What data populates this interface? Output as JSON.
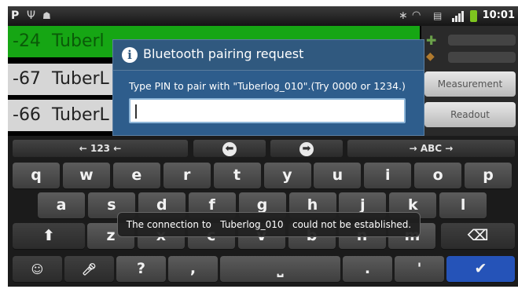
{
  "status_bar": {
    "time": "10:01",
    "left_icons": [
      "p-notification-icon",
      "usb-icon",
      "android-debug-icon"
    ],
    "right_icons": [
      "bluetooth-icon",
      "wifi-icon",
      "sd-card-icon",
      "signal-icon",
      "battery-icon"
    ],
    "p_glyph": "P"
  },
  "app": {
    "rows": [
      {
        "value": "-24",
        "name": "Tuberl"
      },
      {
        "value": "-67",
        "name": "TuberL"
      },
      {
        "value": "-66",
        "name": "TuberL"
      }
    ],
    "buttons": {
      "measurement": "Measurement",
      "readout": "Readout"
    }
  },
  "dialog": {
    "title": "Bluetooth pairing request",
    "message": "Type PIN to pair with \"Tuberlog_010\".(Try 0000 or 1234.)",
    "pin_value": ""
  },
  "toast": {
    "text": "The connection to   Tuberlog_010   could not be established."
  },
  "keyboard": {
    "top_row": {
      "symbols": "← 123 ←",
      "alpha": "→ ABC →"
    },
    "row1": [
      {
        "k": "q",
        "s": ""
      },
      {
        "k": "w",
        "s": ""
      },
      {
        "k": "e",
        "s": ""
      },
      {
        "k": "r",
        "s": ""
      },
      {
        "k": "t",
        "s": ""
      },
      {
        "k": "y",
        "s": ""
      },
      {
        "k": "u",
        "s": ""
      },
      {
        "k": "i",
        "s": ""
      },
      {
        "k": "o",
        "s": ""
      },
      {
        "k": "p",
        "s": ""
      }
    ],
    "row2": [
      {
        "k": "a",
        "s": ""
      },
      {
        "k": "s",
        "s": ""
      },
      {
        "k": "d",
        "s": ""
      },
      {
        "k": "f",
        "s": ""
      },
      {
        "k": "g",
        "s": ""
      },
      {
        "k": "h",
        "s": ""
      },
      {
        "k": "j",
        "s": ""
      },
      {
        "k": "k",
        "s": ""
      },
      {
        "k": "l",
        "s": ""
      }
    ],
    "row3": [
      {
        "k": "z",
        "s": ""
      },
      {
        "k": "x",
        "s": ""
      },
      {
        "k": "c",
        "s": ""
      },
      {
        "k": "v",
        "s": ""
      },
      {
        "k": "b",
        "s": ""
      },
      {
        "k": "n",
        "s": ""
      },
      {
        "k": "m",
        "s": ""
      }
    ],
    "row4": {
      "question": "?",
      "comma": ",",
      "period": ".",
      "apostrophe": "'"
    },
    "enter_color": "#2553b8"
  }
}
